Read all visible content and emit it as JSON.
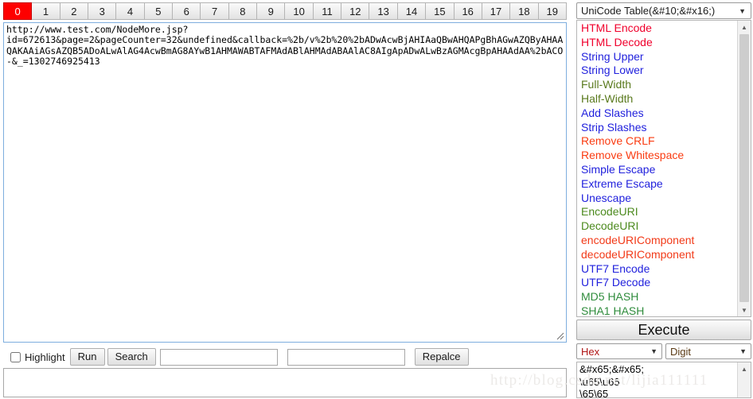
{
  "tabs": {
    "active_index": 0,
    "labels": [
      "0",
      "1",
      "2",
      "3",
      "4",
      "5",
      "6",
      "7",
      "8",
      "9",
      "10",
      "11",
      "12",
      "13",
      "14",
      "15",
      "16",
      "17",
      "18",
      "19"
    ],
    "active_color": "#fe0000"
  },
  "editor": {
    "content": "http://www.test.com/NodeMore.jsp?\nid=672613&page=2&pageCounter=32&undefined&callback=%2b/v%2b%20%2bADwAcwBjAHIAaQBwAHQAPgBhAGwAZQByAHAAQAKAAiAGsAZQB5ADoALwAlAG4AcwBmAG8AYwB1AHMAWABTAFMAdABlAHMAdABAAlAC8AIgApADwALwBzAGMAcgBpAHAAdAA%2bACO\n-&_=1302746925413",
    "placeholder": ""
  },
  "controls": {
    "highlight_label": "Highlight",
    "highlight_checked": false,
    "run_label": "Run",
    "search_label": "Search",
    "search_value": "",
    "search_placeholder": "",
    "replace_value": "",
    "replace_placeholder": "",
    "replace_label": "Repalce"
  },
  "lower_output": {
    "value": "",
    "placeholder": ""
  },
  "sidebar": {
    "mode_select": {
      "value": "UniCode Table(&#10;&#x16;)",
      "caret": "▼"
    },
    "functions": [
      {
        "label": "HTML Encode",
        "color": "#f0002c"
      },
      {
        "label": "HTML Decode",
        "color": "#f0002c"
      },
      {
        "label": "String Upper",
        "color": "#2222dd"
      },
      {
        "label": "String Lower",
        "color": "#2222dd"
      },
      {
        "label": "Full-Width",
        "color": "#5a7a1e"
      },
      {
        "label": "Half-Width",
        "color": "#5a7a1e"
      },
      {
        "label": "Add Slashes",
        "color": "#2222dd"
      },
      {
        "label": "Strip Slashes",
        "color": "#2222dd"
      },
      {
        "label": "Remove CRLF",
        "color": "#fa3c12"
      },
      {
        "label": "Remove Whitespace",
        "color": "#fa3c12"
      },
      {
        "label": "Simple Escape",
        "color": "#2222dd"
      },
      {
        "label": "Extreme Escape",
        "color": "#2222dd"
      },
      {
        "label": "Unescape",
        "color": "#2222dd"
      },
      {
        "label": "EncodeURI",
        "color": "#4c8a1e"
      },
      {
        "label": "DecodeURI",
        "color": "#4c8a1e"
      },
      {
        "label": "encodeURIComponent",
        "color": "#f23a18"
      },
      {
        "label": "decodeURIComponent",
        "color": "#f23a18"
      },
      {
        "label": "UTF7 Encode",
        "color": "#2222dd"
      },
      {
        "label": "UTF7 Decode",
        "color": "#2222dd"
      },
      {
        "label": "MD5 HASH",
        "color": "#2f8c3c"
      },
      {
        "label": "SHA1 HASH",
        "color": "#2f8c3c"
      }
    ],
    "scroll_up_glyph": "▲",
    "scroll_down_glyph": "▼"
  },
  "execute": {
    "label": "Execute"
  },
  "format_selects": {
    "hex": {
      "value": "Hex",
      "caret": "▼"
    },
    "digit": {
      "value": "Digit",
      "caret": "▼"
    }
  },
  "result": {
    "text": "&#x65;&#x65;\n\\u65\\u65\n\\65\\65",
    "scroll_up_glyph": "▲"
  },
  "watermark": {
    "text": "http://blog.csdn.net/lijia111111"
  }
}
